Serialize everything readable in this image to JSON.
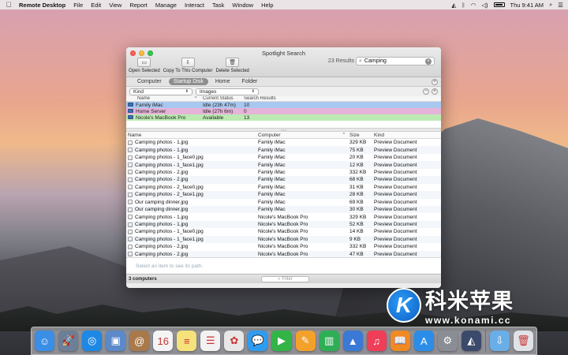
{
  "menubar": {
    "apple": "",
    "app_name": "Remote Desktop",
    "items": [
      "File",
      "Edit",
      "View",
      "Report",
      "Manage",
      "Interact",
      "Task",
      "Window",
      "Help"
    ],
    "clock": "Thu 9:41 AM"
  },
  "window": {
    "title": "Spotlight Search",
    "toolbar": [
      {
        "label": "Open Selected",
        "icon": "folder-open-icon",
        "glyph": "▭"
      },
      {
        "label": "Copy To This Computer",
        "icon": "copy-to-computer-icon",
        "glyph": "⇩"
      },
      {
        "label": "Delete Selected",
        "icon": "trash-icon",
        "glyph": "🗑"
      }
    ],
    "results_count": "23 Results",
    "search": {
      "value": "Camping"
    }
  },
  "scope_tabs": [
    {
      "label": "Computer",
      "active": false
    },
    {
      "label": "Startup Disk",
      "active": true
    },
    {
      "label": "Home",
      "active": false
    },
    {
      "label": "Folder",
      "active": false
    }
  ],
  "criteria": {
    "kind": "Kind",
    "value": "Images"
  },
  "computers": {
    "headers": {
      "name": "Name",
      "status": "Current Status",
      "results": "Search Results"
    },
    "rows": [
      {
        "name": "Family iMac",
        "status": "Idle (23h 47m)",
        "results": "10"
      },
      {
        "name": "Home Server",
        "status": "Idle (27h 6m)",
        "results": "0"
      },
      {
        "name": "Nicole's MacBook Pro",
        "status": "Available",
        "results": "13"
      }
    ]
  },
  "files": {
    "headers": {
      "name": "Name",
      "computer": "Computer",
      "size": "Size",
      "kind": "Kind"
    },
    "rows": [
      {
        "name": "Camping photos - 1.jpg",
        "computer": "Family iMac",
        "size": "329 KB",
        "kind": "Preview Document"
      },
      {
        "name": "Camping photos - 1.jpg",
        "computer": "Family iMac",
        "size": "75 KB",
        "kind": "Preview Document"
      },
      {
        "name": "Camping photos - 1_face0.jpg",
        "computer": "Family iMac",
        "size": "20 KB",
        "kind": "Preview Document"
      },
      {
        "name": "Camping photos - 1_face1.jpg",
        "computer": "Family iMac",
        "size": "12 KB",
        "kind": "Preview Document"
      },
      {
        "name": "Camping photos - 2.jpg",
        "computer": "Family iMac",
        "size": "332 KB",
        "kind": "Preview Document"
      },
      {
        "name": "Camping photos - 2.jpg",
        "computer": "Family iMac",
        "size": "68 KB",
        "kind": "Preview Document"
      },
      {
        "name": "Camping photos - 2_face0.jpg",
        "computer": "Family iMac",
        "size": "31 KB",
        "kind": "Preview Document"
      },
      {
        "name": "Camping photos - 2_face1.jpg",
        "computer": "Family iMac",
        "size": "28 KB",
        "kind": "Preview Document"
      },
      {
        "name": "Our camping dinner.jpg",
        "computer": "Family iMac",
        "size": "69 KB",
        "kind": "Preview Document"
      },
      {
        "name": "Our camping dinner.jpg",
        "computer": "Family iMac",
        "size": "30 KB",
        "kind": "Preview Document"
      },
      {
        "name": "Camping photos - 1.jpg",
        "computer": "Nicole's MacBook Pro",
        "size": "329 KB",
        "kind": "Preview Document"
      },
      {
        "name": "Camping photos - 1.jpg",
        "computer": "Nicole's MacBook Pro",
        "size": "52 KB",
        "kind": "Preview Document"
      },
      {
        "name": "Camping photos - 1_face0.jpg",
        "computer": "Nicole's MacBook Pro",
        "size": "14 KB",
        "kind": "Preview Document"
      },
      {
        "name": "Camping photos - 1_face1.jpg",
        "computer": "Nicole's MacBook Pro",
        "size": "9 KB",
        "kind": "Preview Document"
      },
      {
        "name": "Camping photos - 2.jpg",
        "computer": "Nicole's MacBook Pro",
        "size": "332 KB",
        "kind": "Preview Document"
      },
      {
        "name": "Camping photos - 2.jpg",
        "computer": "Nicole's MacBook Pro",
        "size": "47 KB",
        "kind": "Preview Document"
      }
    ]
  },
  "pathbar": {
    "hint": "Select an item to see its path."
  },
  "statusbar": {
    "count": "3 computers",
    "filter_placeholder": "Filter"
  },
  "watermark": {
    "logo_letter": "K",
    "cn": "科米苹果",
    "url": "www.konami.cc"
  },
  "dock": {
    "apps": [
      {
        "name": "finder-icon",
        "color": "#3a8ee6",
        "glyph": "☺"
      },
      {
        "name": "launchpad-icon",
        "color": "#6d7f96",
        "glyph": "🚀"
      },
      {
        "name": "safari-icon",
        "color": "#1e88e5",
        "glyph": "◎"
      },
      {
        "name": "preview-icon",
        "color": "#5b89c9",
        "glyph": "▣"
      },
      {
        "name": "contacts-icon",
        "color": "#a8794a",
        "glyph": "@"
      },
      {
        "name": "calendar-icon",
        "color": "#f4f4f4",
        "glyph": "16"
      },
      {
        "name": "notes-icon",
        "color": "#f5e27a",
        "glyph": "≡"
      },
      {
        "name": "reminders-icon",
        "color": "#f2f2f2",
        "glyph": "☰"
      },
      {
        "name": "photos-icon",
        "color": "#e7e7e7",
        "glyph": "✿"
      },
      {
        "name": "messages-icon",
        "color": "#2e9cf0",
        "glyph": "💬"
      },
      {
        "name": "facetime-icon",
        "color": "#32b447",
        "glyph": "▶"
      },
      {
        "name": "pages-icon",
        "color": "#f4a12c",
        "glyph": "✎"
      },
      {
        "name": "numbers-icon",
        "color": "#2fae56",
        "glyph": "▥"
      },
      {
        "name": "keynote-icon",
        "color": "#3a79d6",
        "glyph": "▲"
      },
      {
        "name": "itunes-icon",
        "color": "#ef3e58",
        "glyph": "♫"
      },
      {
        "name": "ibooks-icon",
        "color": "#f08a25",
        "glyph": "📖"
      },
      {
        "name": "app-store-icon",
        "color": "#2b8de8",
        "glyph": "A"
      },
      {
        "name": "system-preferences-icon",
        "color": "#8a8d93",
        "glyph": "⚙"
      },
      {
        "name": "remote-desktop-icon",
        "color": "#3b4a6a",
        "glyph": "◭"
      }
    ],
    "trailing": [
      {
        "name": "downloads-folder-icon",
        "color": "#6aaee8",
        "glyph": "⇩"
      },
      {
        "name": "trash-can-icon",
        "color": "#dfe2e6",
        "glyph": "🗑"
      }
    ]
  }
}
